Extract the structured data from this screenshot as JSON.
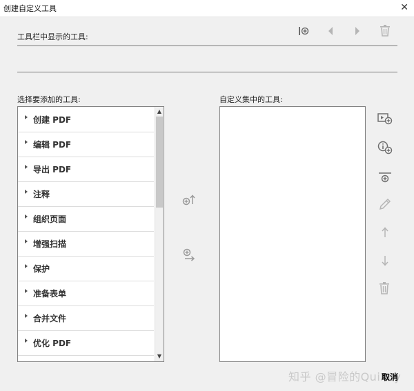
{
  "window": {
    "title": "创建自定义工具",
    "close_glyph": "✕"
  },
  "toolbar_section": {
    "label": "工具栏中显示的工具:"
  },
  "available_section": {
    "label": "选择要添加的工具:",
    "items": [
      "创建 PDF",
      "编辑 PDF",
      "导出 PDF",
      "注释",
      "组织页面",
      "增强扫描",
      "保护",
      "准备表单",
      "合并文件",
      "优化 PDF"
    ]
  },
  "custom_section": {
    "label": "自定义集中的工具:"
  },
  "footer": {
    "cancel_label": "取消",
    "watermark": "知乎 @冒险的Quincy"
  },
  "icons": {
    "toolbar": [
      "add-separator-icon",
      "move-left-icon",
      "move-right-icon",
      "delete-icon"
    ],
    "middle": [
      "add-to-toolbar-icon",
      "add-to-custom-set-icon"
    ],
    "side": [
      "add-tool-icon",
      "add-info-icon",
      "add-separator-icon",
      "edit-icon",
      "move-up-icon",
      "move-down-icon",
      "delete-icon"
    ]
  },
  "colors": {
    "icon_gray": "#9a9a9a",
    "panel_border": "#828282",
    "background": "#f0f0f0"
  }
}
